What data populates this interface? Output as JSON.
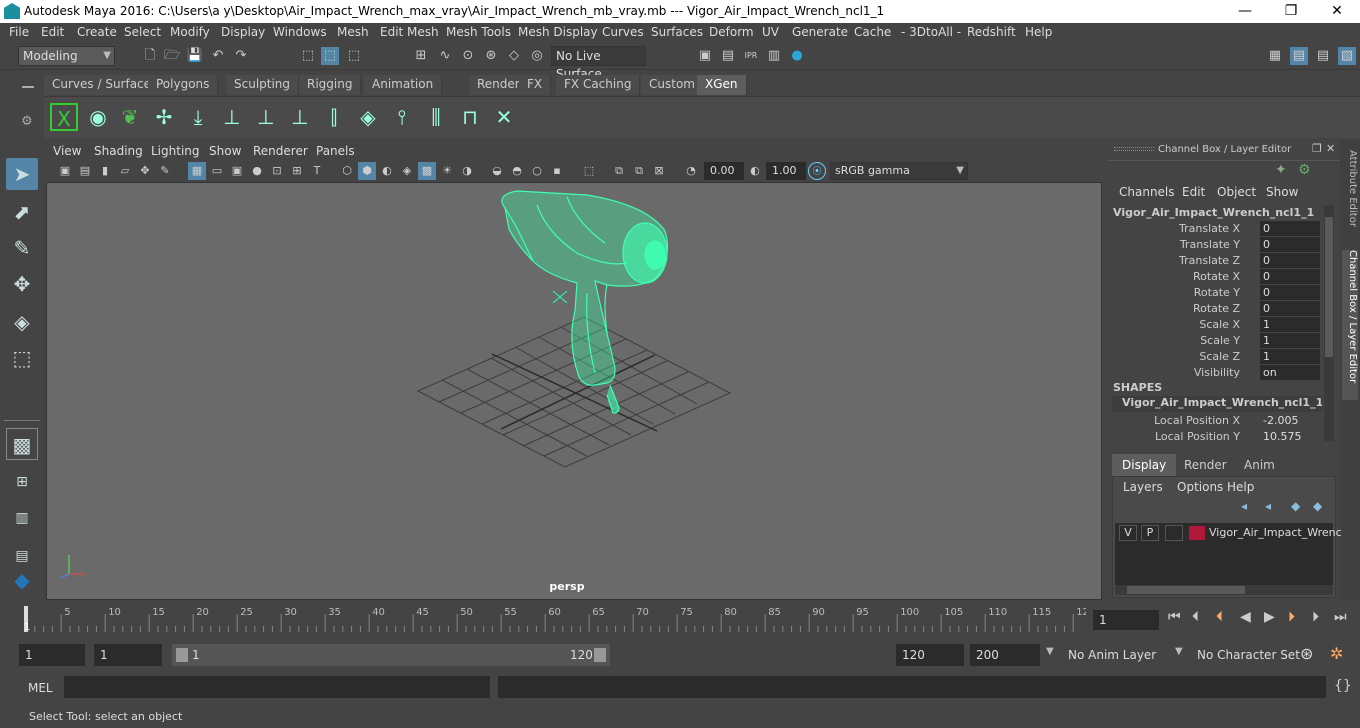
{
  "window": {
    "title": "Autodesk Maya 2016: C:\\Users\\a y\\Desktop\\Air_Impact_Wrench_max_vray\\Air_Impact_Wrench_mb_vray.mb   ---   Vigor_Air_Impact_Wrench_ncl1_1",
    "minimize": "—",
    "maximize": "❐",
    "close": "✕"
  },
  "menubar": [
    "File",
    "Edit",
    "Create",
    "Select",
    "Modify",
    "Display",
    "Windows",
    "Mesh",
    "Edit Mesh",
    "Mesh Tools",
    "Mesh Display",
    "Curves",
    "Surfaces",
    "Deform",
    "UV",
    "Generate",
    "Cache",
    "- 3DtoAll -",
    "Redshift",
    "Help"
  ],
  "toolbar": {
    "mode": "Modeling",
    "live_surface": "No Live Surface"
  },
  "shelf_tabs": [
    "Curves / Surfaces",
    "Polygons",
    "Sculpting",
    "Rigging",
    "Animation",
    "Rendering",
    "FX",
    "FX Caching",
    "Custom",
    "XGen"
  ],
  "active_shelf": "XGen",
  "viewport": {
    "menu": [
      "View",
      "Shading",
      "Lighting",
      "Show",
      "Renderer",
      "Panels"
    ],
    "exposure": "0.00",
    "gamma": "1.00",
    "color_space": "sRGB gamma",
    "camera_label": "persp"
  },
  "channel_box": {
    "header": "Channel Box / Layer Editor",
    "menu": [
      "Channels",
      "Edit",
      "Object",
      "Show"
    ],
    "object_name": "Vigor_Air_Impact_Wrench_ncl1_1",
    "attributes": [
      {
        "label": "Translate X",
        "value": "0"
      },
      {
        "label": "Translate Y",
        "value": "0"
      },
      {
        "label": "Translate Z",
        "value": "0"
      },
      {
        "label": "Rotate X",
        "value": "0"
      },
      {
        "label": "Rotate Y",
        "value": "0"
      },
      {
        "label": "Rotate Z",
        "value": "0"
      },
      {
        "label": "Scale X",
        "value": "1"
      },
      {
        "label": "Scale Y",
        "value": "1"
      },
      {
        "label": "Scale Z",
        "value": "1"
      },
      {
        "label": "Visibility",
        "value": "on"
      }
    ],
    "shapes_header": "SHAPES",
    "shape_name": "Vigor_Air_Impact_Wrench_ncl1_1Sha...",
    "shape_attributes": [
      {
        "label": "Local Position X",
        "value": "-2.005"
      },
      {
        "label": "Local Position Y",
        "value": "10.575"
      }
    ]
  },
  "side_tabs": [
    "Attribute Editor",
    "Channel Box / Layer Editor"
  ],
  "layer_editor": {
    "tabs": [
      "Display",
      "Render",
      "Anim"
    ],
    "active_tab": "Display",
    "menu": [
      "Layers",
      "Options",
      "Help"
    ],
    "layer": {
      "v": "V",
      "p": "P",
      "name": "Vigor_Air_Impact_Wrenc",
      "color": "#b0183a"
    }
  },
  "timeline": {
    "ticks": [
      "5",
      "10",
      "15",
      "20",
      "25",
      "30",
      "35",
      "40",
      "45",
      "50",
      "55",
      "60",
      "65",
      "70",
      "75",
      "80",
      "85",
      "90",
      "95",
      "100",
      "105",
      "110",
      "115",
      "12"
    ],
    "start_marker": "1",
    "current_frame": "1"
  },
  "range": {
    "start": "1",
    "playback_start": "1",
    "slider_start": "1",
    "slider_end": "120",
    "playback_end": "120",
    "end": "200",
    "anim_layer": "No Anim Layer",
    "character_set": "No Character Set"
  },
  "mel": {
    "label": "MEL"
  },
  "status": "Select Tool: select an object",
  "colors": {
    "wireframe": "#3dffb0",
    "accent": "#5285a6"
  }
}
